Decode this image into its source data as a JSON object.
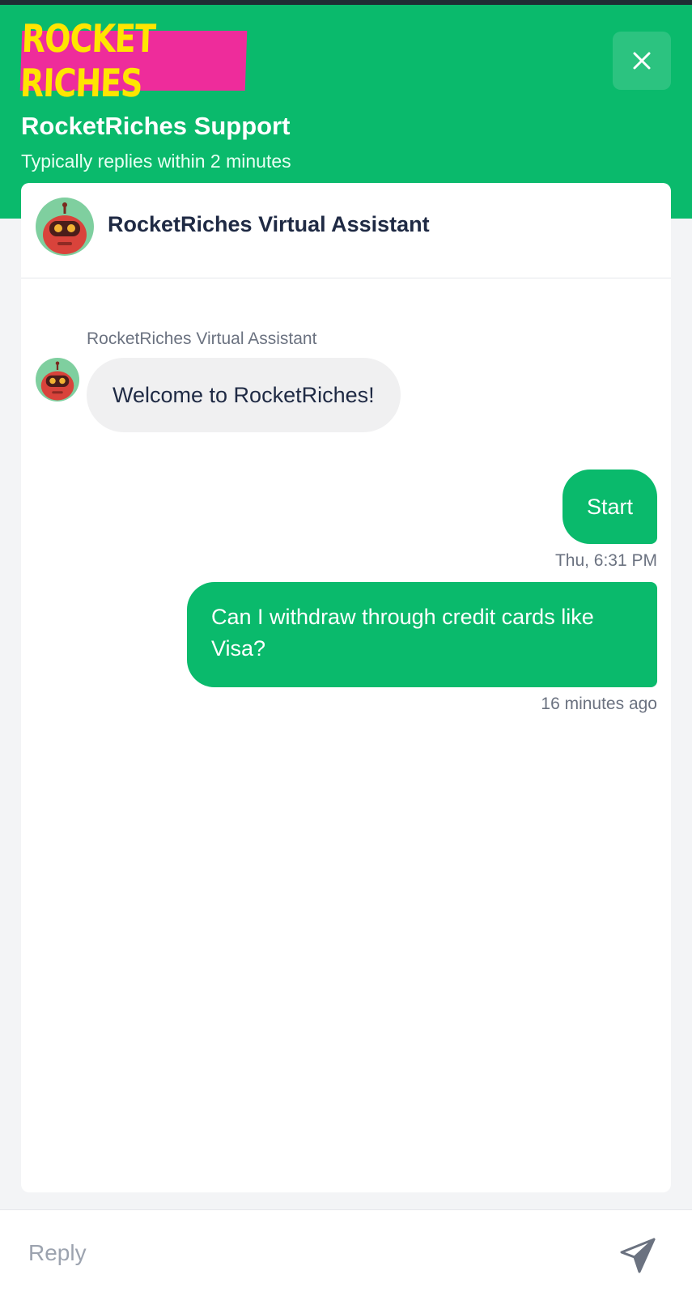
{
  "header": {
    "logo_text": "ROCKET RICHES",
    "title": "RocketRiches Support",
    "subtitle": "Typically replies within 2 minutes",
    "close_icon": "close-icon",
    "colors": {
      "brand_green": "#0aba6c",
      "logo_pink": "#ee2c9b",
      "logo_yellow": "#ffe500"
    }
  },
  "agent": {
    "name": "RocketRiches Virtual Assistant",
    "avatar_icon": "robot-avatar-icon"
  },
  "messages": [
    {
      "from": "agent",
      "sender": "RocketRiches Virtual Assistant",
      "text": "Welcome to RocketRiches!"
    },
    {
      "from": "user",
      "text": "Start",
      "time": "Thu, 6:31 PM"
    },
    {
      "from": "user",
      "text": "Can I withdraw through credit cards like Visa?",
      "time": "16 minutes ago"
    }
  ],
  "composer": {
    "placeholder": "Reply",
    "value": "",
    "send_icon": "send-icon"
  }
}
